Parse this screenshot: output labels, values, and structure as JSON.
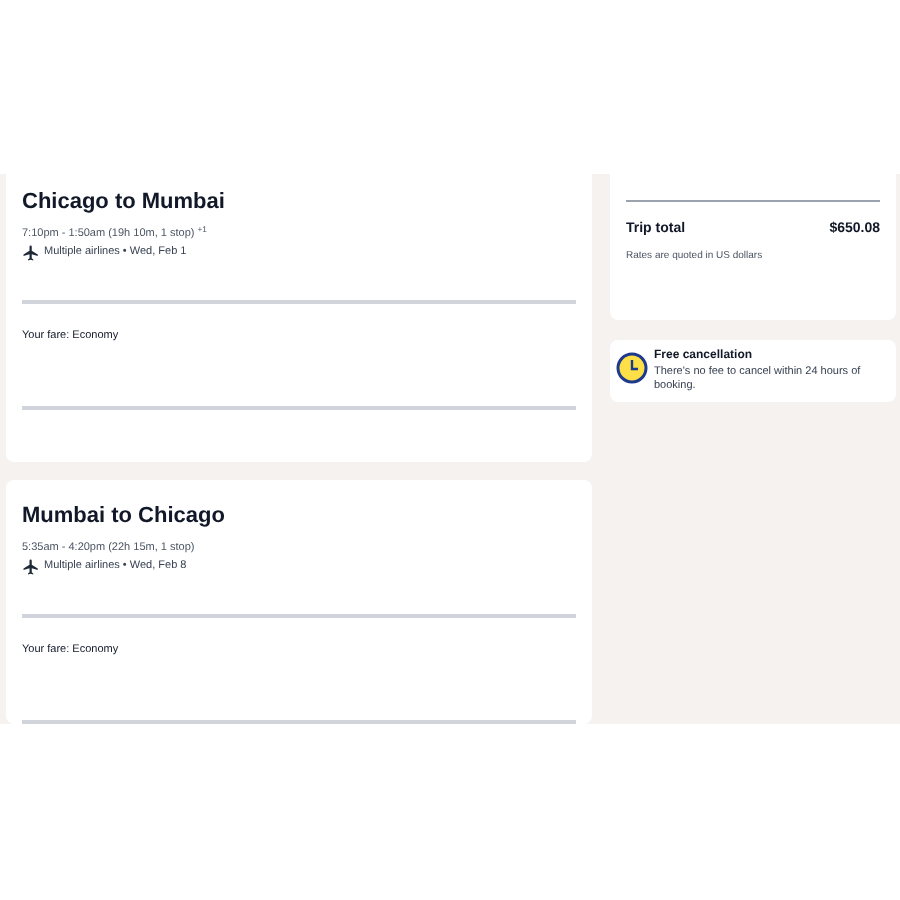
{
  "flights": [
    {
      "title": "Chicago to Mumbai",
      "times": "7:10pm - 1:50am (19h 10m, 1 stop) $^{+1}$",
      "airline_line": "Multiple airlines • Wed, Feb 1",
      "fare": "Your fare: Economy"
    },
    {
      "title": "Mumbai to Chicago",
      "times": "5:35am - 4:20pm (22h 15m, 1 stop)",
      "airline_line": "Multiple airlines • Wed, Feb 8",
      "fare": "Your fare: Economy"
    }
  ],
  "summary": {
    "total_label": "Trip total",
    "total_value": "$650.08",
    "note": "Rates are quoted in US dollars"
  },
  "cancellation": {
    "title": "Free cancellation",
    "text": "There's no fee to cancel within 24 hours of booking."
  }
}
